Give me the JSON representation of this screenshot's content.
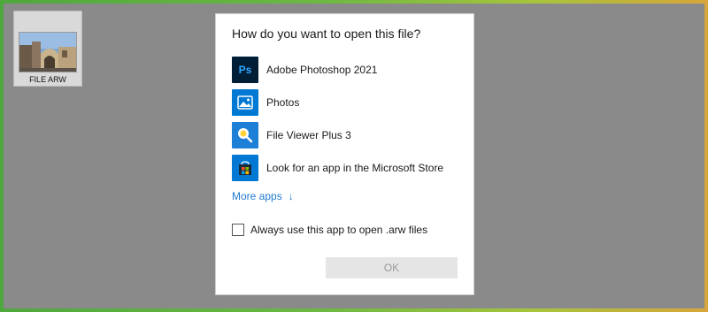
{
  "desktop": {
    "file": {
      "name": "FILE ARW"
    }
  },
  "dialog": {
    "title": "How do you want to open this file?",
    "apps": [
      {
        "name": "Adobe Photoshop 2021",
        "icon": "photoshop-icon",
        "icon_text": "Ps",
        "color": "#001e36"
      },
      {
        "name": "Photos",
        "icon": "photos-icon",
        "color": "#0078d4"
      },
      {
        "name": "File Viewer Plus 3",
        "icon": "file-viewer-plus-icon",
        "color": "#1e7fd6"
      },
      {
        "name": "Look for an app in the Microsoft Store",
        "icon": "microsoft-store-icon",
        "color": "#0078d4"
      }
    ],
    "more_apps": "More apps",
    "more_apps_arrow": "↓",
    "always_label": "Always use this app to open .arw files",
    "always_checked": false,
    "ok_label": "OK"
  },
  "colors": {
    "accent": "#1f78d1",
    "desktop_bg": "#8a8a8a"
  }
}
